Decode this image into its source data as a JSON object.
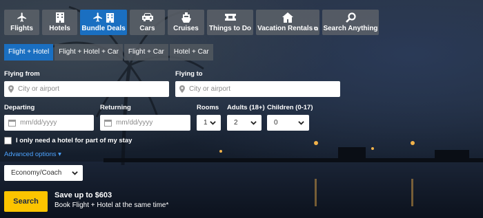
{
  "tabs": [
    {
      "label": "Flights",
      "icon": "airplane-icon",
      "active": false
    },
    {
      "label": "Hotels",
      "icon": "building-icon",
      "active": false
    },
    {
      "label": "Bundle Deals",
      "icon": "airplane-building-icon",
      "active": true
    },
    {
      "label": "Cars",
      "icon": "car-icon",
      "active": false
    },
    {
      "label": "Cruises",
      "icon": "ship-icon",
      "active": false
    },
    {
      "label": "Things to Do",
      "icon": "ticket-icon",
      "active": false
    },
    {
      "label": "Vacation Rentals",
      "icon": "house-icon",
      "active": false
    },
    {
      "label": "Search Anything",
      "icon": "magnifier-icon",
      "active": false
    }
  ],
  "subtabs": [
    {
      "label": "Flight + Hotel",
      "active": true
    },
    {
      "label": "Flight + Hotel + Car",
      "active": false
    },
    {
      "label": "Flight + Car",
      "active": false
    },
    {
      "label": "Hotel + Car",
      "active": false
    }
  ],
  "form": {
    "flying_from_label": "Flying from",
    "flying_from_placeholder": "City or airport",
    "flying_to_label": "Flying to",
    "flying_to_placeholder": "City or airport",
    "departing_label": "Departing",
    "departing_placeholder": "mm/dd/yyyy",
    "returning_label": "Returning",
    "returning_placeholder": "mm/dd/yyyy",
    "rooms_label": "Rooms",
    "rooms_value": "1",
    "adults_label": "Adults (18+)",
    "adults_value": "2",
    "children_label": "Children (0-17)",
    "children_value": "0",
    "partial_hotel_label": "I only need a hotel for part of my stay",
    "advanced_options": "Advanced options ▾",
    "cabin_class": "Economy/Coach",
    "search_label": "Search",
    "promo_title": "Save up to $603",
    "promo_subtitle": "Book Flight + Hotel at the same time*"
  },
  "colors": {
    "active_tab": "#1a6fc1",
    "search_button": "#fcc400",
    "link": "#4da3ff"
  }
}
